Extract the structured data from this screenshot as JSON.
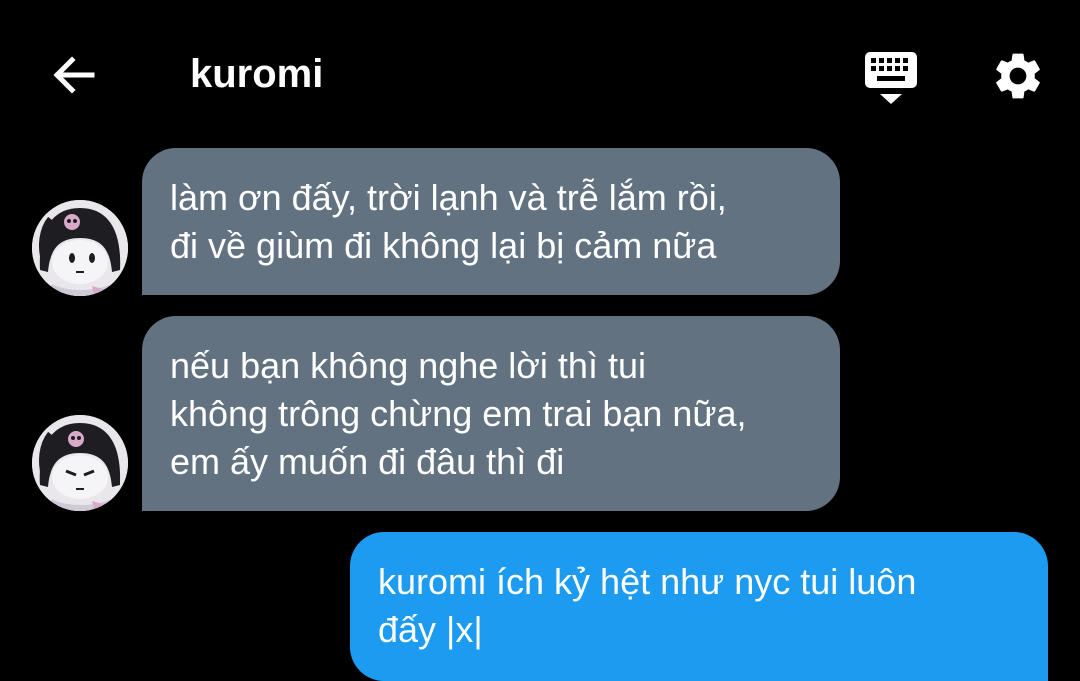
{
  "header": {
    "title": "kuromi",
    "back_icon": "arrow-left-icon",
    "keyboard_icon": "keyboard-icon",
    "settings_icon": "gear-icon"
  },
  "messages": [
    {
      "side": "incoming",
      "sender_icon": "kuromi-avatar",
      "lines": [
        "làm ơn đấy, trời lạnh và trễ lắm rồi,",
        "đi về giùm đi không lại bị cảm nữa"
      ]
    },
    {
      "side": "incoming",
      "sender_icon": "kuromi-avatar",
      "lines": [
        "nếu bạn không nghe lời thì tui",
        "không trông chừng em trai bạn nữa,",
        "em ấy muốn đi đâu thì đi"
      ]
    },
    {
      "side": "outgoing",
      "lines": [
        "kuromi ích kỷ hệt như nyc tui luôn",
        "đấy |x|"
      ]
    }
  ],
  "colors": {
    "background": "#000000",
    "incoming_bubble": "#627280",
    "outgoing_bubble": "#1c9bf0",
    "text": "#ffffff"
  }
}
